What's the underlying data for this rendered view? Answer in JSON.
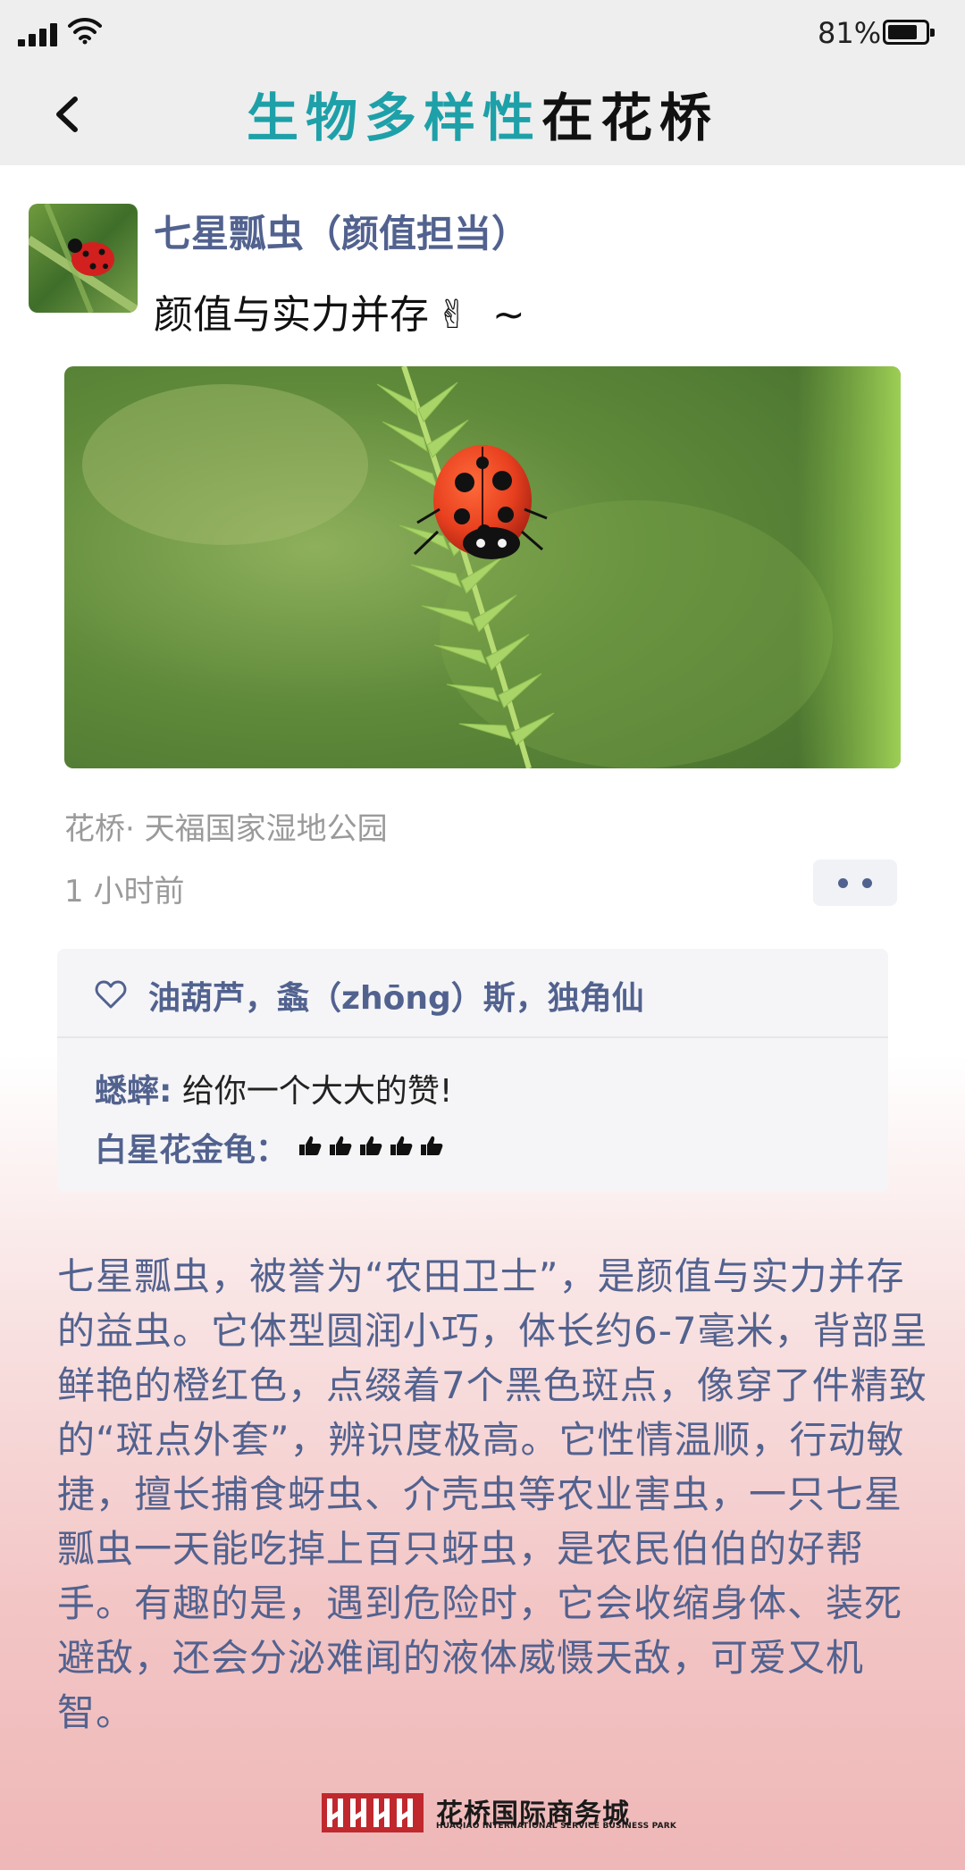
{
  "status_bar": {
    "battery_percent_text": "81%",
    "battery_level": 0.81
  },
  "header": {
    "title_part1": "生物多样性",
    "title_part2": "在花桥",
    "accent_color": "#1ea0a8"
  },
  "post": {
    "title": "七星瓢虫（颜值担当）",
    "subtitle": "颜值与实力并存",
    "subtitle_emoji": "✌",
    "subtitle_tilde": "~",
    "location": "花桥· 天福国家湿地公园",
    "time": "1 小时前"
  },
  "interactions": {
    "likers": "油葫芦，螽（zhōng）斯，独角仙",
    "comments": [
      {
        "author": "蟋蟀",
        "separator": ":",
        "text": "给你一个大大的赞!"
      },
      {
        "author": "白星花金龟",
        "separator": "：",
        "text": ""
      }
    ]
  },
  "article": {
    "body": "七星瓢虫，被誉为“农田卫士”，是颜值与实力并存的益虫。它体型圆润小巧，体长约6-7毫米，背部呈鲜艳的橙红色，点缀着7个黑色斑点，像穿了件精致的“斑点外套”，辨识度极高。它性情温顺，行动敏捷，擅长捕食蚜虫、介壳虫等农业害虫，一只七星瓢虫一天能吃掉上百只蚜虫，是农民伯伯的好帮手。有趣的是，遇到危险时，它会收缩身体、装死避敌，还会分泌难闻的液体威慑天敌，可爱又机智。"
  },
  "footer": {
    "brand": "花桥国际商务城",
    "brand_en": "HUAQIAO INTERNATIONAL SERVICE BUSINESS PARK",
    "logo_color": "#c0282d"
  },
  "colors": {
    "link_blue": "#52628f",
    "gray_text": "#9a9a9a",
    "header_bg": "#eeeeee"
  },
  "icons": [
    "signal-icon",
    "wifi-icon",
    "battery-icon",
    "back-chevron-icon",
    "heart-icon",
    "thumbs-up-icon",
    "more-dots-icon"
  ]
}
